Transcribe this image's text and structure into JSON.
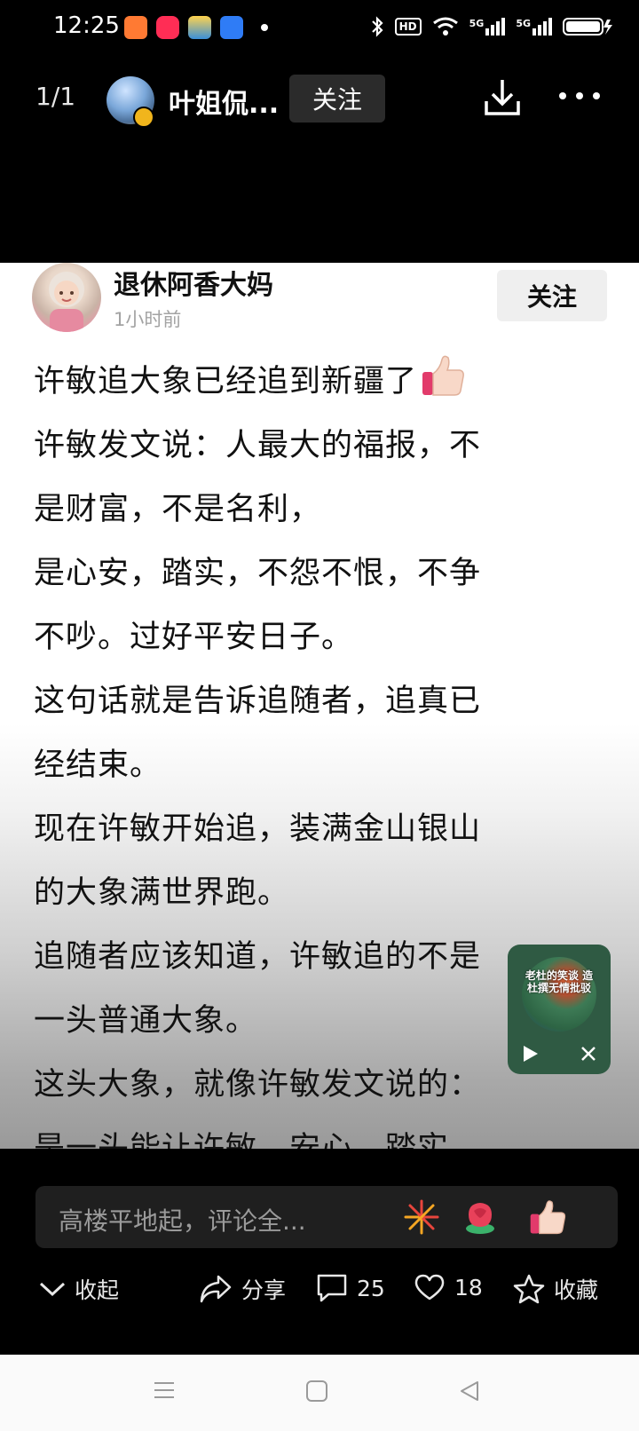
{
  "status_bar": {
    "time": "12:25",
    "hd_label": "HD",
    "network_1": "5G",
    "network_2": "5G",
    "app_icons": [
      "kuaishou-icon",
      "video-app-icon",
      "game-app-icon",
      "search-app-icon"
    ]
  },
  "top_bar": {
    "page_counter": "1/1",
    "author_name": "叶姐侃...",
    "follow_label": "关注",
    "download_icon": "download-icon",
    "more_icon": "more-icon"
  },
  "post": {
    "poster_name": "退休阿香大妈",
    "poster_time": "1小时前",
    "follow_label": "关注",
    "lines": [
      "许敏追大象已经追到新疆了",
      "许敏发文说：人最大的福报，不",
      "是财富，不是名利，",
      "是心安，踏实，不怨不恨，不争",
      "不吵。过好平安日子。",
      "这句话就是告诉追随者，追真已",
      "经结束。",
      "现在许敏开始追，装满金山银山",
      "的大象满世界跑。",
      "追随者应该知道，许敏追的不是",
      "一头普通大象。",
      "这头大象，就像许敏发文说的：",
      "是一头能让许敏，安心，踏实"
    ]
  },
  "mini_player": {
    "title": "老杜的笑谈 造杜撰无情批驳",
    "play_icon": "play-icon",
    "close_icon": "close-icon"
  },
  "comment_bar": {
    "placeholder": "高楼平地起，评论全...",
    "emojis": [
      "firework-emoji",
      "rose-emoji",
      "thumbs-up-emoji"
    ]
  },
  "actions": {
    "collapse": "收起",
    "share": "分享",
    "comments": "25",
    "likes": "18",
    "favorite": "收藏"
  },
  "nav_bar": {
    "icons": [
      "menu-icon",
      "home-icon",
      "back-icon"
    ]
  },
  "colors": {
    "background": "#000000",
    "card": "#ffffff",
    "comment_box": "#1f1f1f",
    "mini_player": "#2f5a43"
  }
}
